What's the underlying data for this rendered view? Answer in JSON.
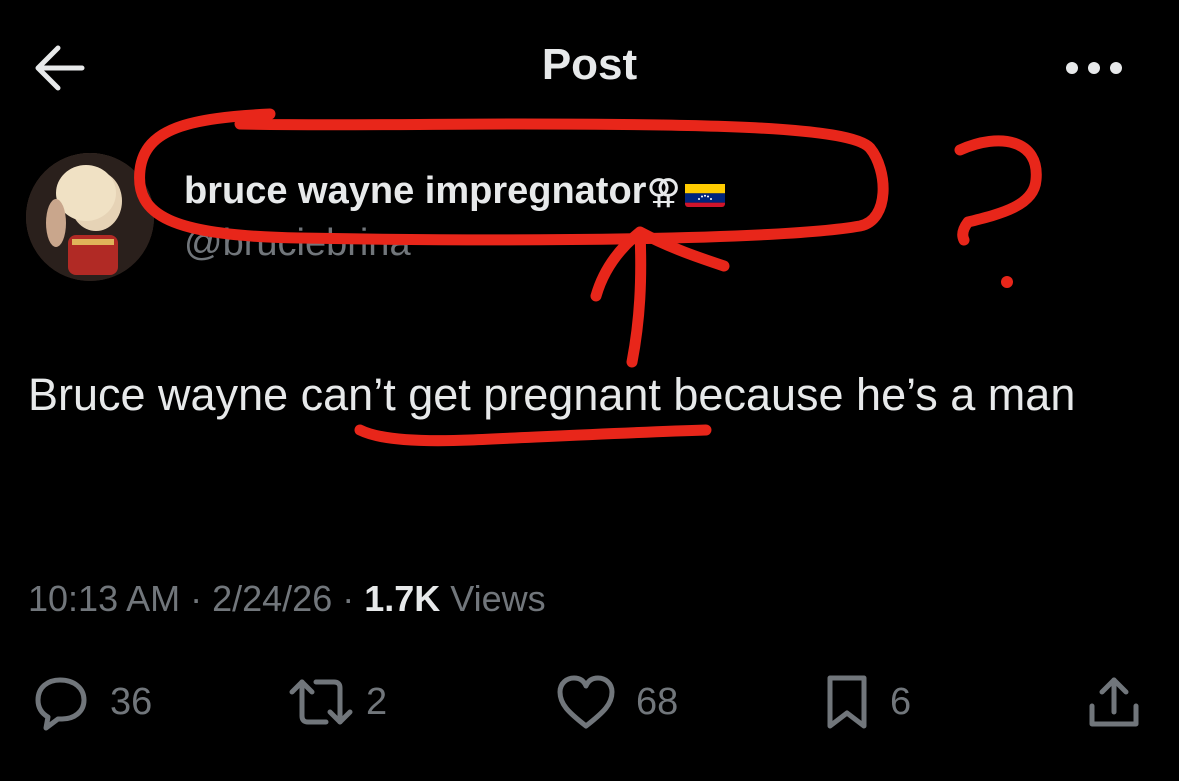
{
  "header": {
    "title": "Post",
    "back_icon": "arrow-left-icon",
    "more_icon": "more-dots-icon"
  },
  "author": {
    "display_name": "bruce wayne impregnator",
    "name_emoji": "⚢",
    "flag": "venezuela-flag",
    "handle": "@bruciebrina"
  },
  "post": {
    "text": "Bruce wayne can’t get pregnant because he’s a man"
  },
  "meta": {
    "time": "10:13 AM",
    "sep1": " · ",
    "date": "2/24/26",
    "sep2": " · ",
    "views_count": "1.7K",
    "views_label": " Views"
  },
  "actions": {
    "replies": "36",
    "reposts": "2",
    "likes": "68",
    "bookmarks": "6"
  },
  "annotation": {
    "color": "#e8261a",
    "question_mark": "?"
  },
  "colors": {
    "background": "#000000",
    "text": "#e7e9ea",
    "secondary": "#71767b"
  }
}
